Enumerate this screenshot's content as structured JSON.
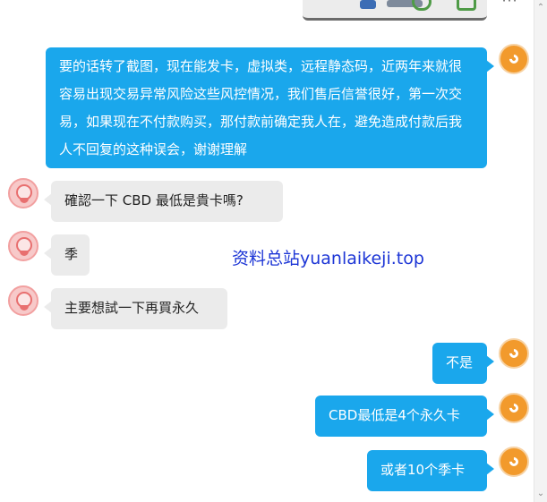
{
  "window": {
    "scroll_up_glyph": "⌃",
    "scroll_down_glyph": "⌄"
  },
  "top_icons": [
    "phone-icon",
    "document-icon",
    "more-icon"
  ],
  "messages": [
    {
      "side": "right",
      "text": "要的话转了截图，现在能发卡，虚拟类，远程静态码，近两年来就很容易出现交易异常风险这些风控情况，我们售后信誉很好，第一次交易，如果现在不付款购买，那付款前确定我人在，避免造成付款后我人不回复的这种误会，谢谢理解"
    },
    {
      "side": "left",
      "text": "確認一下 CBD 最低是貴卡嗎?"
    },
    {
      "side": "left",
      "text": "季"
    },
    {
      "side": "left",
      "text": "主要想試一下再買永久"
    },
    {
      "side": "right",
      "text": "不是"
    },
    {
      "side": "right",
      "text": "CBD最低是4个永久卡"
    },
    {
      "side": "right",
      "text": "或者10个季卡"
    }
  ],
  "watermark": "资料总站yuanlaikeji.top",
  "colors": {
    "right_bubble": "#1aa7ec",
    "left_bubble": "#ebebeb",
    "right_avatar": "#f29a2c",
    "left_avatar": "#f7c9c9",
    "watermark": "#1d36d6"
  }
}
